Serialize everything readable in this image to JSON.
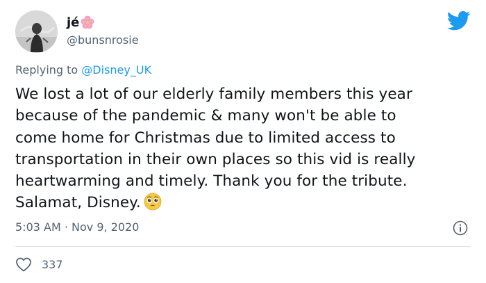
{
  "author": {
    "name": "jé",
    "handle": "@bunsnrosie"
  },
  "reply": {
    "prefix": "Replying to",
    "mention": "@Disney_UK"
  },
  "body": {
    "lines": [
      "We lost a lot of our elderly family members this year",
      "because of the pandemic & many won't be able to",
      "come home for Christmas due to limited access to",
      "transportation in their own places so this vid is really",
      "heartwarming and timely. Thank you for the tribute.",
      "Salamat, Disney."
    ],
    "emoji": "pleading-face-emoji"
  },
  "meta": {
    "timestamp": "5:03 AM · Nov 9, 2020"
  },
  "engagement": {
    "likes": "337"
  },
  "colors": {
    "brand": "#1d9bf0",
    "text": "#0f1419",
    "muted": "#536471"
  }
}
